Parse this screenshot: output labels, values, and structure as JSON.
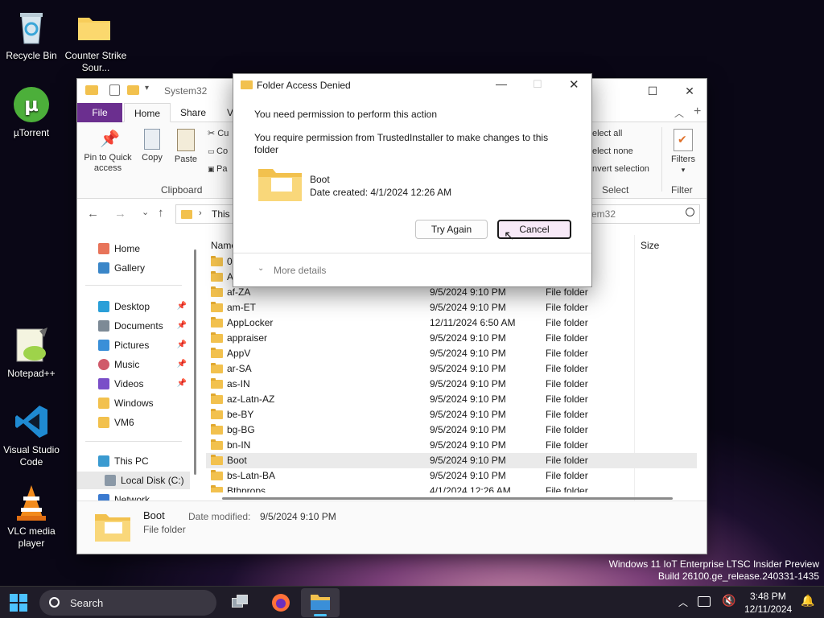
{
  "desktop": {
    "icons": [
      {
        "label": "Recycle Bin"
      },
      {
        "label": "Counter Strike Sour..."
      },
      {
        "label": "µTorrent"
      },
      {
        "label": "Notepad++"
      },
      {
        "label": "Visual Studio Code"
      },
      {
        "label": "VLC media player"
      }
    ]
  },
  "explorer": {
    "title": "System32",
    "tabs": [
      "File",
      "Home",
      "Share",
      "V"
    ],
    "ribbon": {
      "pin_label": "Pin to Quick access",
      "copy_label": "Copy",
      "paste_label": "Paste",
      "cut_label": "Cu",
      "copy_path_label": "Co",
      "paste_shortcut_label": "Pa",
      "clipboard_group": "Clipboard",
      "select_all": "elect all",
      "select_none": "elect none",
      "invert_selection": "nvert selection",
      "select_group": "Select",
      "filters_label": "Filters",
      "filter_group": "Filter"
    },
    "address": {
      "crumb": "This",
      "search_partial": "em32"
    },
    "nav": [
      {
        "label": "Home",
        "pinned": false
      },
      {
        "label": "Gallery",
        "pinned": false
      },
      {
        "label": "Desktop",
        "pinned": true
      },
      {
        "label": "Documents",
        "pinned": true
      },
      {
        "label": "Pictures",
        "pinned": true
      },
      {
        "label": "Music",
        "pinned": true
      },
      {
        "label": "Videos",
        "pinned": true
      },
      {
        "label": "Windows",
        "pinned": false
      },
      {
        "label": "VM6",
        "pinned": false
      },
      {
        "label": "This PC",
        "pinned": false
      },
      {
        "label": "Local Disk (C:)",
        "pinned": false
      },
      {
        "label": "Network",
        "pinned": false
      }
    ],
    "columns": {
      "name": "Name",
      "size": "Size"
    },
    "rows": [
      {
        "name": "0",
        "date": "",
        "type": ""
      },
      {
        "name": "A",
        "date": "",
        "type": ""
      },
      {
        "name": "af-ZA",
        "date": "9/5/2024 9:10 PM",
        "type": "File folder"
      },
      {
        "name": "am-ET",
        "date": "9/5/2024 9:10 PM",
        "type": "File folder"
      },
      {
        "name": "AppLocker",
        "date": "12/11/2024 6:50 AM",
        "type": "File folder"
      },
      {
        "name": "appraiser",
        "date": "9/5/2024 9:10 PM",
        "type": "File folder"
      },
      {
        "name": "AppV",
        "date": "9/5/2024 9:10 PM",
        "type": "File folder"
      },
      {
        "name": "ar-SA",
        "date": "9/5/2024 9:10 PM",
        "type": "File folder"
      },
      {
        "name": "as-IN",
        "date": "9/5/2024 9:10 PM",
        "type": "File folder"
      },
      {
        "name": "az-Latn-AZ",
        "date": "9/5/2024 9:10 PM",
        "type": "File folder"
      },
      {
        "name": "be-BY",
        "date": "9/5/2024 9:10 PM",
        "type": "File folder"
      },
      {
        "name": "bg-BG",
        "date": "9/5/2024 9:10 PM",
        "type": "File folder"
      },
      {
        "name": "bn-IN",
        "date": "9/5/2024 9:10 PM",
        "type": "File folder"
      },
      {
        "name": "Boot",
        "date": "9/5/2024 9:10 PM",
        "type": "File folder"
      },
      {
        "name": "bs-Latn-BA",
        "date": "9/5/2024 9:10 PM",
        "type": "File folder"
      },
      {
        "name": "Bthprops",
        "date": "4/1/2024 12:26 AM",
        "type": "File folder"
      }
    ],
    "details": {
      "name": "Boot",
      "type": "File folder",
      "modified_label": "Date modified:",
      "modified_value": "9/5/2024 9:10 PM"
    }
  },
  "dialog": {
    "title": "Folder Access Denied",
    "heading": "You need permission to perform this action",
    "message": "You require permission from TrustedInstaller to make changes to this folder",
    "item_name": "Boot",
    "item_date": "Date created: 4/1/2024 12:26 AM",
    "try_again": "Try Again",
    "cancel": "Cancel",
    "more_details": "More details"
  },
  "taskbar": {
    "search_placeholder": "Search",
    "time": "3:48 PM",
    "date": "12/11/2024"
  },
  "watermark": {
    "line1": "Windows 11 IoT Enterprise LTSC Insider Preview",
    "line2": "Build 26100.ge_release.240331-1435"
  }
}
